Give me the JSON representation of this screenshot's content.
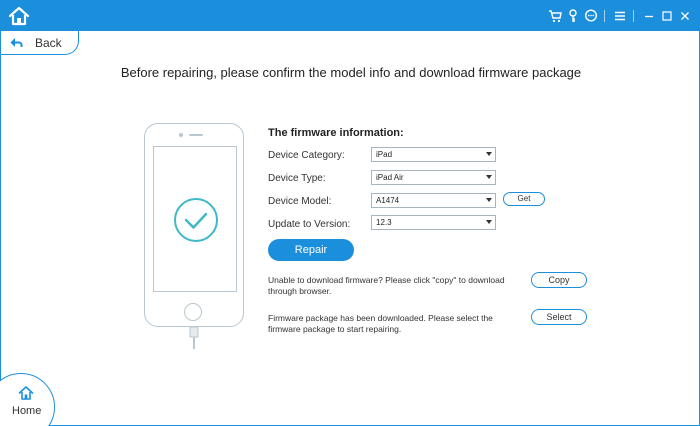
{
  "window": {
    "toolbar_icons": [
      "cart-icon",
      "key-icon",
      "chat-icon",
      "menu-icon",
      "minimize-icon",
      "maximize-icon",
      "close-icon"
    ],
    "accent_color": "#1c8fdc"
  },
  "nav": {
    "back_label": "Back",
    "home_label": "Home"
  },
  "page": {
    "title": "Before repairing, please confirm the model info and download firmware package"
  },
  "firmware": {
    "section_title": "The firmware information:",
    "fields": [
      {
        "label": "Device Category:",
        "value": "iPad"
      },
      {
        "label": "Device Type:",
        "value": "iPad Air"
      },
      {
        "label": "Device Model:",
        "value": "A1474"
      },
      {
        "label": "Update to Version:",
        "value": "12.3"
      }
    ],
    "get_label": "Get",
    "repair_label": "Repair",
    "copy_note": "Unable to download firmware? Please click \"copy\" to download through browser.",
    "copy_label": "Copy",
    "select_note": "Firmware package has been downloaded. Please select the firmware package to start repairing.",
    "select_label": "Select"
  }
}
